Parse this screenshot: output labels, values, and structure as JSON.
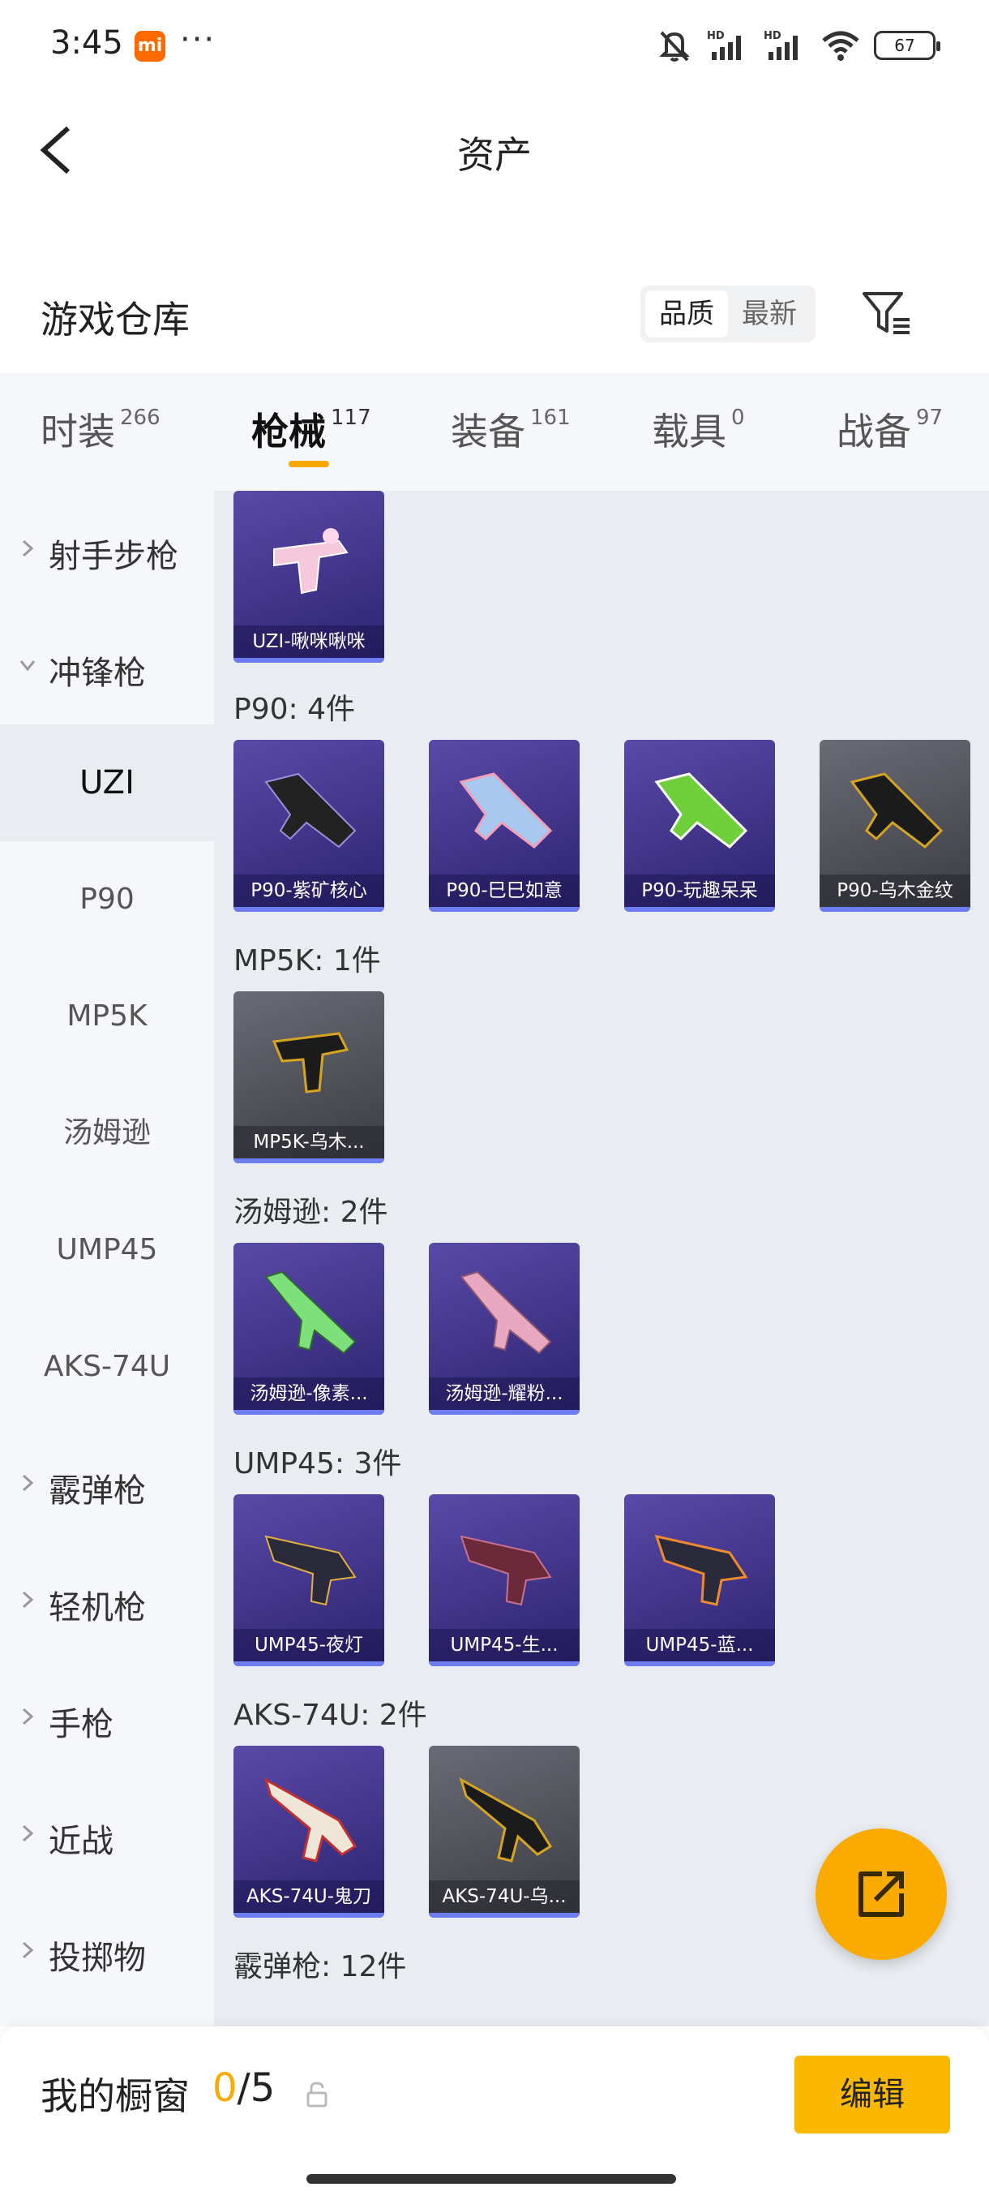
{
  "status_bar": {
    "time": "3:45",
    "app_badge": "mi",
    "more": "···",
    "battery": "67",
    "icons": [
      "mute-icon",
      "hd-signal-icon",
      "hd-signal-icon",
      "wifi-icon",
      "battery-icon"
    ]
  },
  "header": {
    "title": "资产"
  },
  "section": {
    "title": "游戏仓库",
    "sort_options": [
      "品质",
      "最新"
    ],
    "sort_selected": "品质"
  },
  "category_tabs": [
    {
      "label": "时装",
      "count": "266",
      "active": false
    },
    {
      "label": "枪械",
      "count": "117",
      "active": true
    },
    {
      "label": "装备",
      "count": "161",
      "active": false
    },
    {
      "label": "载具",
      "count": "0",
      "active": false
    },
    {
      "label": "战备",
      "count": "97",
      "active": false
    }
  ],
  "sidebar": {
    "top_items": [
      {
        "label": "射手步枪",
        "expanded": false
      },
      {
        "label": "冲锋枪",
        "expanded": true
      }
    ],
    "sub_items": [
      "UZI",
      "P90",
      "MP5K",
      "汤姆逊",
      "UMP45",
      "AKS-74U"
    ],
    "sub_selected": "UZI",
    "bottom_items": [
      {
        "label": "霰弹枪"
      },
      {
        "label": "轻机枪"
      },
      {
        "label": "手枪"
      },
      {
        "label": "近战"
      },
      {
        "label": "投掷物"
      }
    ]
  },
  "groups": [
    {
      "label": "",
      "items": [
        {
          "name": "UZI-啾咪啾咪",
          "tier": "purple"
        }
      ]
    },
    {
      "label": "P90: 4件",
      "items": [
        {
          "name": "P90-紫矿核心",
          "tier": "purple"
        },
        {
          "name": "P90-巳巳如意",
          "tier": "purple"
        },
        {
          "name": "P90-玩趣呆呆",
          "tier": "purple"
        },
        {
          "name": "P90-乌木金纹",
          "tier": "gray"
        }
      ]
    },
    {
      "label": "MP5K: 1件",
      "items": [
        {
          "name": "MP5K-乌木...",
          "tier": "gray"
        }
      ]
    },
    {
      "label": "汤姆逊: 2件",
      "items": [
        {
          "name": "汤姆逊-像素...",
          "tier": "purple"
        },
        {
          "name": "汤姆逊-耀粉...",
          "tier": "purple"
        }
      ]
    },
    {
      "label": "UMP45: 3件",
      "items": [
        {
          "name": "UMP45-夜灯",
          "tier": "purple"
        },
        {
          "name": "UMP45-生...",
          "tier": "purple"
        },
        {
          "name": "UMP45-蓝...",
          "tier": "purple"
        }
      ]
    },
    {
      "label": "AKS-74U: 2件",
      "items": [
        {
          "name": "AKS-74U-鬼刀",
          "tier": "purple"
        },
        {
          "name": "AKS-74U-乌...",
          "tier": "gray"
        }
      ]
    },
    {
      "label": "霰弹枪: 12件",
      "items": []
    }
  ],
  "bottom_bar": {
    "showcase_label": "我的橱窗",
    "count_current": "0",
    "count_sep": "/",
    "count_total": "5",
    "edit_label": "编辑"
  },
  "colors": {
    "accent": "#fbab00",
    "purple_card": "#3e3290",
    "gray_card": "#55555e",
    "rarity_bar": "#6d7cf0"
  }
}
